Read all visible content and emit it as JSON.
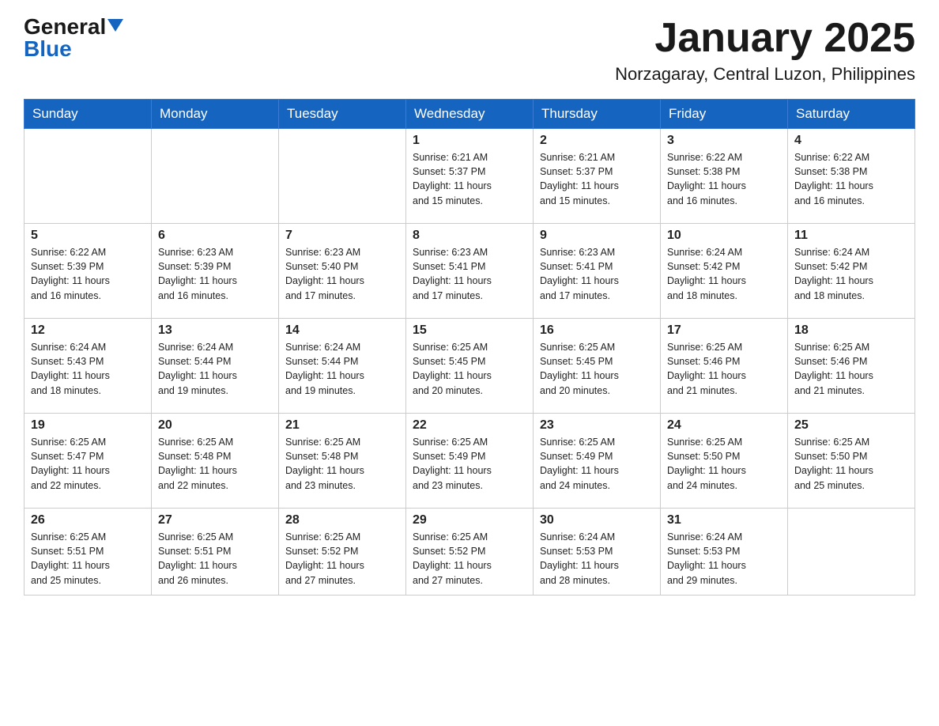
{
  "logo": {
    "general": "General",
    "blue": "Blue"
  },
  "title": {
    "month": "January 2025",
    "location": "Norzagaray, Central Luzon, Philippines"
  },
  "weekdays": [
    "Sunday",
    "Monday",
    "Tuesday",
    "Wednesday",
    "Thursday",
    "Friday",
    "Saturday"
  ],
  "weeks": [
    [
      {
        "day": "",
        "info": ""
      },
      {
        "day": "",
        "info": ""
      },
      {
        "day": "",
        "info": ""
      },
      {
        "day": "1",
        "info": "Sunrise: 6:21 AM\nSunset: 5:37 PM\nDaylight: 11 hours\nand 15 minutes."
      },
      {
        "day": "2",
        "info": "Sunrise: 6:21 AM\nSunset: 5:37 PM\nDaylight: 11 hours\nand 15 minutes."
      },
      {
        "day": "3",
        "info": "Sunrise: 6:22 AM\nSunset: 5:38 PM\nDaylight: 11 hours\nand 16 minutes."
      },
      {
        "day": "4",
        "info": "Sunrise: 6:22 AM\nSunset: 5:38 PM\nDaylight: 11 hours\nand 16 minutes."
      }
    ],
    [
      {
        "day": "5",
        "info": "Sunrise: 6:22 AM\nSunset: 5:39 PM\nDaylight: 11 hours\nand 16 minutes."
      },
      {
        "day": "6",
        "info": "Sunrise: 6:23 AM\nSunset: 5:39 PM\nDaylight: 11 hours\nand 16 minutes."
      },
      {
        "day": "7",
        "info": "Sunrise: 6:23 AM\nSunset: 5:40 PM\nDaylight: 11 hours\nand 17 minutes."
      },
      {
        "day": "8",
        "info": "Sunrise: 6:23 AM\nSunset: 5:41 PM\nDaylight: 11 hours\nand 17 minutes."
      },
      {
        "day": "9",
        "info": "Sunrise: 6:23 AM\nSunset: 5:41 PM\nDaylight: 11 hours\nand 17 minutes."
      },
      {
        "day": "10",
        "info": "Sunrise: 6:24 AM\nSunset: 5:42 PM\nDaylight: 11 hours\nand 18 minutes."
      },
      {
        "day": "11",
        "info": "Sunrise: 6:24 AM\nSunset: 5:42 PM\nDaylight: 11 hours\nand 18 minutes."
      }
    ],
    [
      {
        "day": "12",
        "info": "Sunrise: 6:24 AM\nSunset: 5:43 PM\nDaylight: 11 hours\nand 18 minutes."
      },
      {
        "day": "13",
        "info": "Sunrise: 6:24 AM\nSunset: 5:44 PM\nDaylight: 11 hours\nand 19 minutes."
      },
      {
        "day": "14",
        "info": "Sunrise: 6:24 AM\nSunset: 5:44 PM\nDaylight: 11 hours\nand 19 minutes."
      },
      {
        "day": "15",
        "info": "Sunrise: 6:25 AM\nSunset: 5:45 PM\nDaylight: 11 hours\nand 20 minutes."
      },
      {
        "day": "16",
        "info": "Sunrise: 6:25 AM\nSunset: 5:45 PM\nDaylight: 11 hours\nand 20 minutes."
      },
      {
        "day": "17",
        "info": "Sunrise: 6:25 AM\nSunset: 5:46 PM\nDaylight: 11 hours\nand 21 minutes."
      },
      {
        "day": "18",
        "info": "Sunrise: 6:25 AM\nSunset: 5:46 PM\nDaylight: 11 hours\nand 21 minutes."
      }
    ],
    [
      {
        "day": "19",
        "info": "Sunrise: 6:25 AM\nSunset: 5:47 PM\nDaylight: 11 hours\nand 22 minutes."
      },
      {
        "day": "20",
        "info": "Sunrise: 6:25 AM\nSunset: 5:48 PM\nDaylight: 11 hours\nand 22 minutes."
      },
      {
        "day": "21",
        "info": "Sunrise: 6:25 AM\nSunset: 5:48 PM\nDaylight: 11 hours\nand 23 minutes."
      },
      {
        "day": "22",
        "info": "Sunrise: 6:25 AM\nSunset: 5:49 PM\nDaylight: 11 hours\nand 23 minutes."
      },
      {
        "day": "23",
        "info": "Sunrise: 6:25 AM\nSunset: 5:49 PM\nDaylight: 11 hours\nand 24 minutes."
      },
      {
        "day": "24",
        "info": "Sunrise: 6:25 AM\nSunset: 5:50 PM\nDaylight: 11 hours\nand 24 minutes."
      },
      {
        "day": "25",
        "info": "Sunrise: 6:25 AM\nSunset: 5:50 PM\nDaylight: 11 hours\nand 25 minutes."
      }
    ],
    [
      {
        "day": "26",
        "info": "Sunrise: 6:25 AM\nSunset: 5:51 PM\nDaylight: 11 hours\nand 25 minutes."
      },
      {
        "day": "27",
        "info": "Sunrise: 6:25 AM\nSunset: 5:51 PM\nDaylight: 11 hours\nand 26 minutes."
      },
      {
        "day": "28",
        "info": "Sunrise: 6:25 AM\nSunset: 5:52 PM\nDaylight: 11 hours\nand 27 minutes."
      },
      {
        "day": "29",
        "info": "Sunrise: 6:25 AM\nSunset: 5:52 PM\nDaylight: 11 hours\nand 27 minutes."
      },
      {
        "day": "30",
        "info": "Sunrise: 6:24 AM\nSunset: 5:53 PM\nDaylight: 11 hours\nand 28 minutes."
      },
      {
        "day": "31",
        "info": "Sunrise: 6:24 AM\nSunset: 5:53 PM\nDaylight: 11 hours\nand 29 minutes."
      },
      {
        "day": "",
        "info": ""
      }
    ]
  ]
}
